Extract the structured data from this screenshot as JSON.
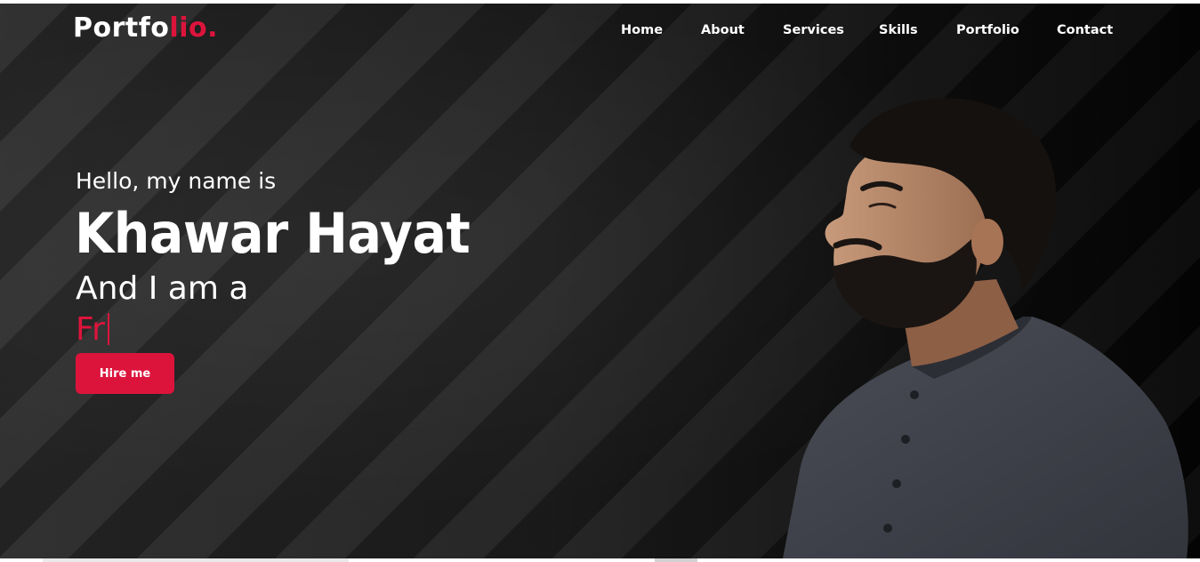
{
  "brand": {
    "logo_main": "Portfo",
    "logo_accent": "lio.",
    "accent_color": "#dc143c"
  },
  "nav": {
    "items": [
      {
        "label": "Home"
      },
      {
        "label": "About"
      },
      {
        "label": "Services"
      },
      {
        "label": "Skills"
      },
      {
        "label": "Portfolio"
      },
      {
        "label": "Contact"
      }
    ]
  },
  "hero": {
    "greeting": "Hello, my name is",
    "name": "Khawar Hayat",
    "role_prefix": "And I am a",
    "typed_text": "Fr",
    "cta_label": "Hire me",
    "background_color": "#1f1f1f"
  },
  "icons": {
    "typing_cursor": "text-caret"
  }
}
